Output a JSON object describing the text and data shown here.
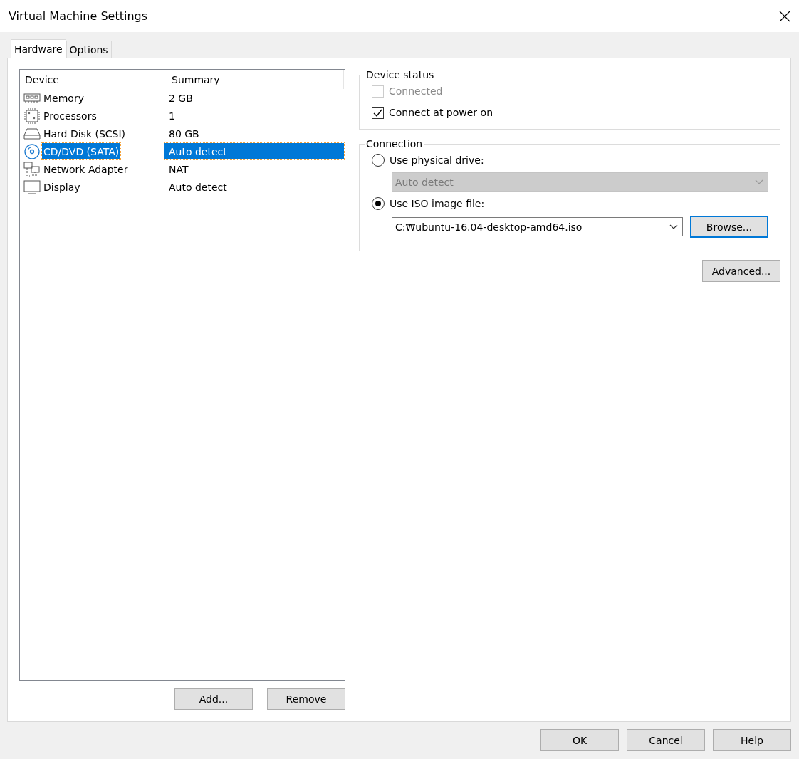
{
  "window": {
    "title": "Virtual Machine Settings"
  },
  "tabs": [
    {
      "label": "Hardware",
      "selected": true
    },
    {
      "label": "Options",
      "selected": false
    }
  ],
  "device_list": {
    "columns": [
      "Device",
      "Summary"
    ],
    "rows": [
      {
        "kind": "memory",
        "device": "Memory",
        "summary": "2 GB",
        "selected": false
      },
      {
        "kind": "processor",
        "device": "Processors",
        "summary": "1",
        "selected": false
      },
      {
        "kind": "disk",
        "device": "Hard Disk (SCSI)",
        "summary": "80 GB",
        "selected": false
      },
      {
        "kind": "cd",
        "device": "CD/DVD (SATA)",
        "summary": "Auto detect",
        "selected": true
      },
      {
        "kind": "network",
        "device": "Network Adapter",
        "summary": "NAT",
        "selected": false
      },
      {
        "kind": "display",
        "device": "Display",
        "summary": "Auto detect",
        "selected": false
      }
    ],
    "buttons": [
      "Add...",
      "Remove"
    ]
  },
  "device_status": {
    "title": "Device status",
    "checkboxes": [
      {
        "label": "Connected",
        "checked": false,
        "disabled": true
      },
      {
        "label": "Connect at power on",
        "checked": true,
        "disabled": false
      }
    ]
  },
  "connection": {
    "title": "Connection",
    "physical": {
      "label": "Use physical drive:",
      "selected": false,
      "dropdown": {
        "value": "Auto detect",
        "disabled": true
      }
    },
    "iso": {
      "label": "Use ISO image file:",
      "selected": true,
      "value": "C:₩ubuntu-16.04-desktop-amd64.iso",
      "browse": "Browse..."
    }
  },
  "advanced_button": "Advanced...",
  "footer_buttons": [
    "OK",
    "Cancel",
    "Help"
  ]
}
